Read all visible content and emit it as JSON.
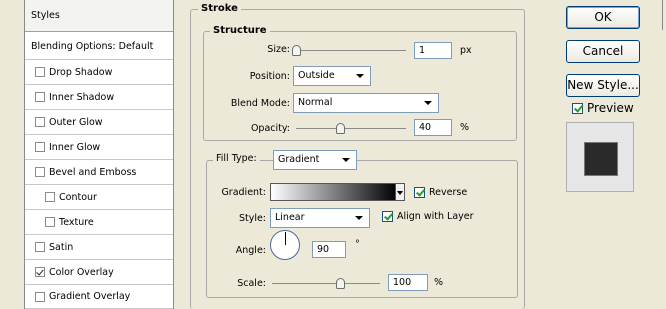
{
  "styles_panel": {
    "header": "Styles",
    "blending_options": "Blending Options: Default",
    "items": [
      {
        "label": "Drop Shadow",
        "checked": false
      },
      {
        "label": "Inner Shadow",
        "checked": false
      },
      {
        "label": "Outer Glow",
        "checked": false
      },
      {
        "label": "Inner Glow",
        "checked": false
      },
      {
        "label": "Bevel and Emboss",
        "checked": false
      },
      {
        "label": "Contour",
        "checked": false
      },
      {
        "label": "Texture",
        "checked": false
      },
      {
        "label": "Satin",
        "checked": false
      },
      {
        "label": "Color Overlay",
        "checked": true
      },
      {
        "label": "Gradient Overlay",
        "checked": false
      }
    ]
  },
  "stroke": {
    "title": "Stroke",
    "structure": {
      "title": "Structure",
      "size_label": "Size:",
      "size_value": "1",
      "size_unit": "px",
      "position_label": "Position:",
      "position_value": "Outside",
      "blend_mode_label": "Blend Mode:",
      "blend_mode_value": "Normal",
      "opacity_label": "Opacity:",
      "opacity_value": "40",
      "opacity_unit": "%"
    },
    "fill": {
      "fill_type_label": "Fill Type:",
      "fill_type_value": "Gradient",
      "gradient_label": "Gradient:",
      "reverse_label": "Reverse",
      "reverse_checked": true,
      "style_label": "Style:",
      "style_value": "Linear",
      "align_label": "Align with Layer",
      "align_checked": true,
      "angle_label": "Angle:",
      "angle_value": "90",
      "angle_unit": "°",
      "scale_label": "Scale:",
      "scale_value": "100",
      "scale_unit": "%"
    }
  },
  "buttons": {
    "ok": "OK",
    "cancel": "Cancel",
    "new_style": "New Style...",
    "preview_label": "Preview",
    "preview_checked": true
  }
}
